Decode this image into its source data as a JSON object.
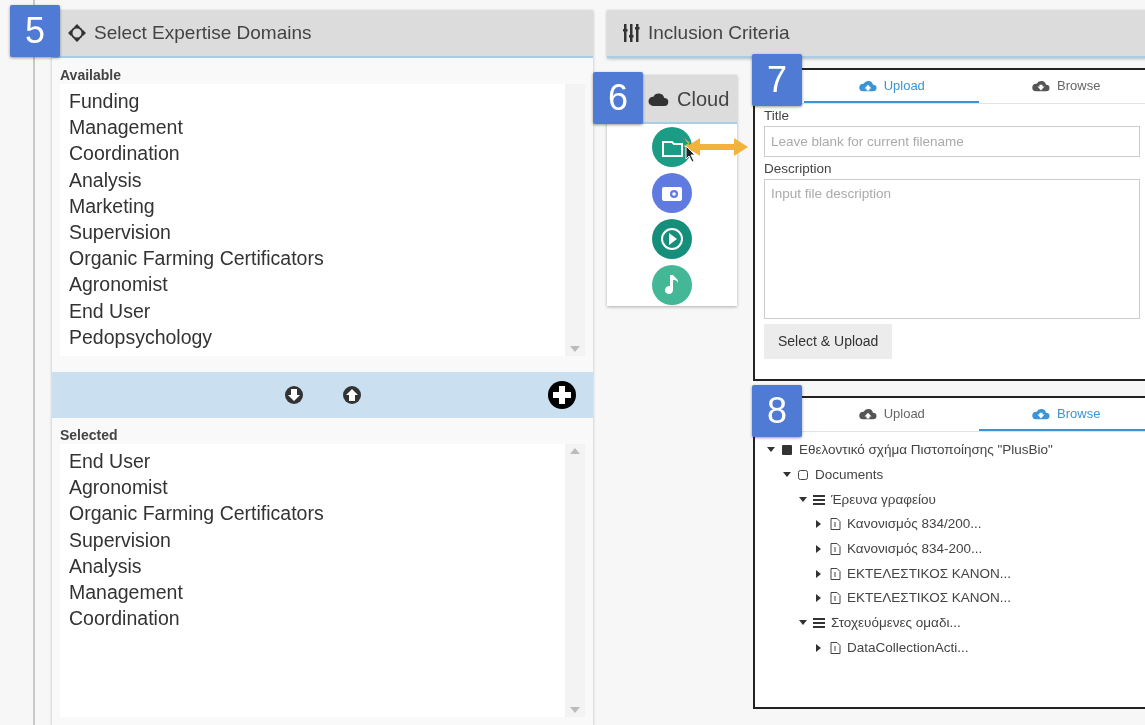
{
  "expertise": {
    "callout": "5",
    "title": "Select Expertise Domains",
    "available_label": "Available",
    "available": [
      "Funding",
      "Management",
      "Coordination",
      "Analysis",
      "Marketing",
      "Supervision",
      "Organic Farming Certificators",
      "Agronomist",
      "End User",
      "Pedopsychology"
    ],
    "selected_label": "Selected",
    "selected": [
      "End User",
      "Agronomist",
      "Organic Farming Certificators",
      "Supervision",
      "Analysis",
      "Management",
      "Coordination"
    ]
  },
  "inclusion": {
    "title": "Inclusion Criteria"
  },
  "cloud": {
    "callout": "6",
    "title": "Cloud",
    "buttons": [
      {
        "kind": "folder"
      },
      {
        "kind": "camera"
      },
      {
        "kind": "video"
      },
      {
        "kind": "music"
      }
    ]
  },
  "upload_panel": {
    "callout": "7",
    "tabs": [
      {
        "label": "Upload",
        "kind": "upload",
        "selected": true
      },
      {
        "label": "Browse",
        "kind": "browse",
        "selected": false
      }
    ],
    "title_label": "Title",
    "title_placeholder": "Leave blank for current filename",
    "description_label": "Description",
    "description_placeholder": "Input file description",
    "button": "Select & Upload"
  },
  "browse_panel": {
    "callout": "8",
    "tabs": [
      {
        "label": "Upload",
        "kind": "upload",
        "selected": false
      },
      {
        "label": "Browse",
        "kind": "browse",
        "selected": true
      }
    ],
    "tree": [
      {
        "label": "Εθελοντικό σχήμα Πιστοποίησης \"PlusBio\"",
        "kind": "project",
        "expanded": true,
        "children": [
          {
            "label": "Documents",
            "kind": "folder",
            "expanded": true,
            "children": [
              {
                "label": "Έρευνα γραφείου",
                "kind": "group",
                "expanded": true,
                "children": [
                  {
                    "label": "Κανονισμός 834/200...",
                    "kind": "file",
                    "expanded": false
                  },
                  {
                    "label": "Κανονισμός 834-200...",
                    "kind": "file",
                    "expanded": false
                  },
                  {
                    "label": "ΕΚΤΕΛΕΣΤΙΚΟΣ ΚΑΝΟΝ...",
                    "kind": "file",
                    "expanded": false
                  },
                  {
                    "label": "ΕΚΤΕΛΕΣΤΙΚΟΣ ΚΑΝΟΝ...",
                    "kind": "file",
                    "expanded": false
                  }
                ]
              },
              {
                "label": "Στοχευόμενες ομαδι...",
                "kind": "group",
                "expanded": true,
                "children": [
                  {
                    "label": "DataCollectionActi...",
                    "kind": "file",
                    "expanded": false
                  }
                ]
              }
            ]
          }
        ]
      }
    ]
  }
}
